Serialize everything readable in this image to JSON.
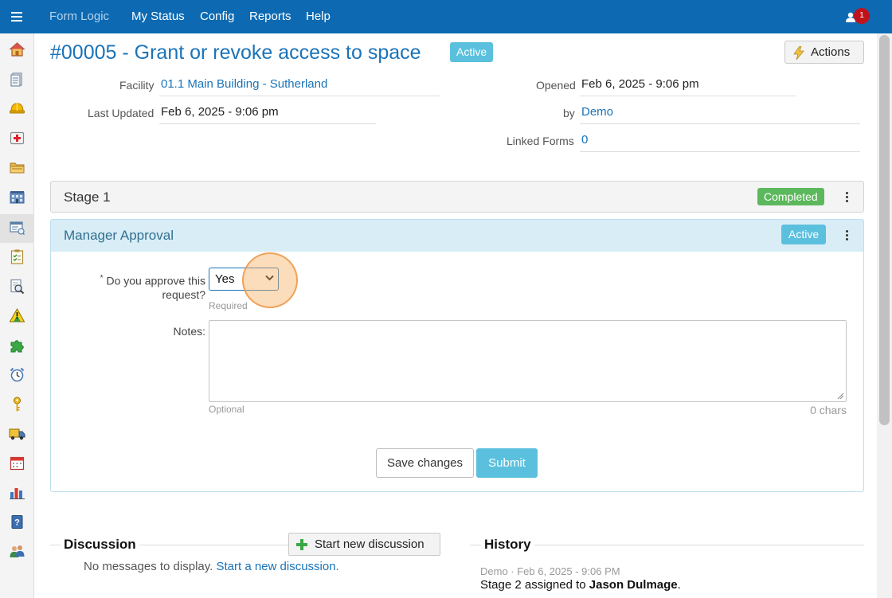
{
  "topbar": {
    "brand": "Form Logic",
    "nav": [
      "My Status",
      "Config",
      "Reports",
      "Help"
    ],
    "notification_count": "1",
    "color": "#0d6ab2"
  },
  "sidebar": {
    "icons": [
      "home-icon",
      "document-icon",
      "hardhat-icon",
      "first-aid-icon",
      "folder-icon",
      "building-icon",
      "forms-icon",
      "checklist-icon",
      "inspection-icon",
      "hazard-icon",
      "puzzle-icon",
      "alarm-clock-icon",
      "key-icon",
      "truck-icon",
      "calendar-icon",
      "bar-chart-icon",
      "help-book-icon",
      "users-icon"
    ],
    "active_index": 6
  },
  "header": {
    "title": "#00005 - Grant or revoke access to space",
    "status": "Active",
    "actions_label": "Actions"
  },
  "details": {
    "facility_label": "Facility",
    "facility_value": "01.1 Main Building - Sutherland",
    "last_updated_label": "Last Updated",
    "last_updated_value": "Feb 6, 2025 - 9:06 pm",
    "opened_label": "Opened",
    "opened_value": "Feb 6, 2025 - 9:06 pm",
    "by_label": "by",
    "by_value": "Demo",
    "linked_forms_label": "Linked Forms",
    "linked_forms_value": "0"
  },
  "stage1": {
    "title": "Stage 1",
    "status": "Completed"
  },
  "approval": {
    "title": "Manager Approval",
    "status": "Active",
    "required_mark": "*",
    "question": "Do you approve this request?",
    "answer": "Yes",
    "question_hint": "Required",
    "notes_label": "Notes:",
    "notes_value": "",
    "notes_hint": "Optional",
    "char_count": "0 chars",
    "save_label": "Save changes",
    "submit_label": "Submit"
  },
  "discussion": {
    "title": "Discussion",
    "start_button": "Start new discussion",
    "empty_text": "No messages to display.",
    "empty_link": "Start a new discussion."
  },
  "history": {
    "title": "History",
    "entry_meta": "Demo · Feb 6, 2025 - 9:06 PM",
    "entry_text_prefix": "Stage 2 assigned to ",
    "entry_name": "Jason Dulmage",
    "entry_text_suffix": "."
  }
}
